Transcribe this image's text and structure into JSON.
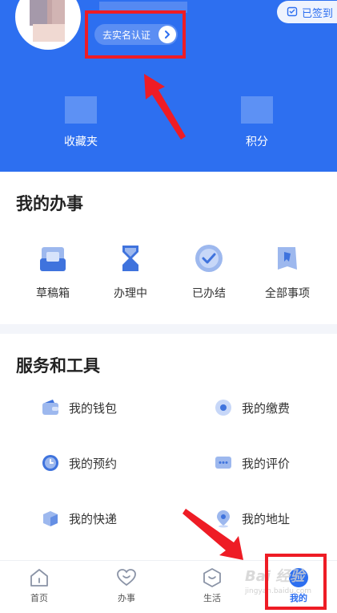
{
  "header": {
    "verify_label": "去实名认证",
    "signin_label": "已签到",
    "stats": [
      {
        "label": "收藏夹"
      },
      {
        "label": "积分"
      }
    ]
  },
  "my_matters": {
    "title": "我的办事",
    "items": [
      {
        "label": "草稿箱",
        "icon": "draft-box-icon"
      },
      {
        "label": "办理中",
        "icon": "hourglass-icon"
      },
      {
        "label": "已办结",
        "icon": "check-circle-icon"
      },
      {
        "label": "全部事项",
        "icon": "all-matters-icon"
      }
    ]
  },
  "services": {
    "title": "服务和工具",
    "items": [
      {
        "label": "我的钱包",
        "icon": "wallet-icon"
      },
      {
        "label": "我的缴费",
        "icon": "payment-icon"
      },
      {
        "label": "我的预约",
        "icon": "clock-icon"
      },
      {
        "label": "我的评价",
        "icon": "comment-icon"
      },
      {
        "label": "我的快递",
        "icon": "package-icon"
      },
      {
        "label": "我的地址",
        "icon": "location-pin-icon"
      }
    ]
  },
  "bottom_nav": {
    "items": [
      {
        "label": "首页",
        "icon": "home-icon"
      },
      {
        "label": "办事",
        "icon": "heart-icon"
      },
      {
        "label": "生活",
        "icon": "life-icon"
      },
      {
        "label": "我的",
        "icon": "profile-icon",
        "active": true
      }
    ]
  },
  "watermark": {
    "text": "Bai 经验",
    "sub": "jingyan.baidu.com"
  },
  "colors": {
    "primary": "#2d6ff0",
    "annotation_red": "#ee1c25"
  }
}
